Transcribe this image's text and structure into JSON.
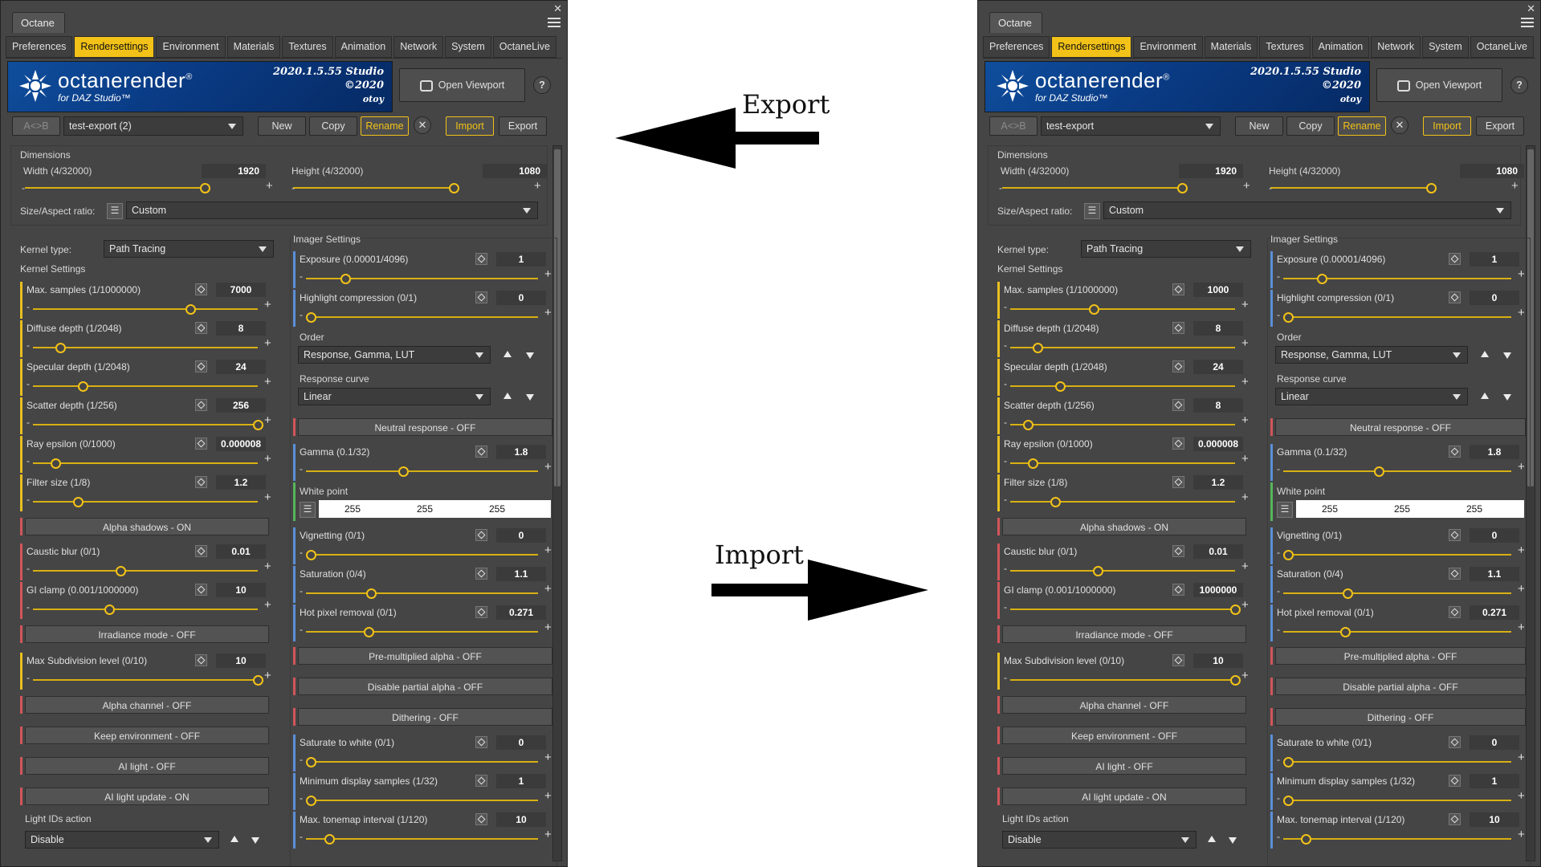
{
  "annotations": {
    "export_label": "Export",
    "import_label": "Import"
  },
  "panels": [
    {
      "window_title": "Octane",
      "tabs": [
        "Preferences",
        "Rendersettings",
        "Environment",
        "Materials",
        "Textures",
        "Animation",
        "Network",
        "System",
        "OctaneLive"
      ],
      "active_tab": "Rendersettings",
      "banner": {
        "brand": "octanerender",
        "brand_mark": "®",
        "subtitle": "for DAZ Studio™",
        "version_line1": "2020.1.5.55 Studio",
        "version_line2": "©2020",
        "company": "otoy"
      },
      "open_viewport_label": "Open Viewport",
      "help_label": "?",
      "toolbar": {
        "ab_label": "A<>B",
        "preset": "test-export (2)",
        "new": "New",
        "copy": "Copy",
        "rename": "Rename",
        "import": "Import",
        "export": "Export"
      },
      "dimensions": {
        "title": "Dimensions",
        "width_label": "Width (4/32000)",
        "width": "1920",
        "height_label": "Height (4/32000)",
        "height": "1080",
        "aspect_label": "Size/Aspect ratio:",
        "aspect_value": "Custom"
      },
      "kernel": {
        "type_label": "Kernel type:",
        "type_value": "Path Tracing",
        "settings_title": "Kernel Settings"
      },
      "kernel_params": [
        {
          "label": "Max. samples (1/1000000)",
          "value": "7000",
          "pos": 0.7
        },
        {
          "label": "Diffuse depth (1/2048)",
          "value": "8",
          "pos": 0.12
        },
        {
          "label": "Specular depth (1/2048)",
          "value": "24",
          "pos": 0.22
        },
        {
          "label": "Scatter depth (1/256)",
          "value": "256",
          "pos": 1.0
        },
        {
          "label": "Ray epsilon (0/1000)",
          "value": "0.000008",
          "pos": 0.1
        },
        {
          "label": "Filter size (1/8)",
          "value": "1.2",
          "pos": 0.2
        }
      ],
      "toggle_alpha_shadows": "Alpha shadows - ON",
      "kernel_params_2": [
        {
          "label": "Caustic blur (0/1)",
          "value": "0.01",
          "pos": 0.39
        },
        {
          "label": "GI clamp (0.001/1000000)",
          "value": "10",
          "pos": 0.34
        }
      ],
      "toggle_irradiance": "Irradiance mode - OFF",
      "kernel_params_3": [
        {
          "label": "Max Subdivision level (0/10)",
          "value": "10",
          "pos": 1.0
        }
      ],
      "kernel_toggles": [
        "Alpha channel - OFF",
        "Keep environment - OFF",
        "AI light - OFF",
        "AI light update - ON"
      ],
      "light_ids": {
        "label": "Light IDs action",
        "value": "Disable"
      },
      "imager": {
        "title": "Imager Settings"
      },
      "imager_params_1": [
        {
          "label": "Exposure (0.00001/4096)",
          "value": "1",
          "pos": 0.17
        },
        {
          "label": "Highlight compression (0/1)",
          "value": "0",
          "pos": 0.02
        }
      ],
      "order": {
        "label": "Order",
        "value": "Response, Gamma, LUT"
      },
      "response_curve": {
        "label": "Response curve",
        "value": "Linear"
      },
      "toggle_neutral": "Neutral response - OFF",
      "imager_params_2": [
        {
          "label": "Gamma (0.1/32)",
          "value": "1.8",
          "pos": 0.42
        }
      ],
      "white_point": {
        "label": "White point",
        "r": "255",
        "g": "255",
        "b": "255"
      },
      "imager_params_3": [
        {
          "label": "Vignetting (0/1)",
          "value": "0",
          "pos": 0.02
        },
        {
          "label": "Saturation (0/4)",
          "value": "1.1",
          "pos": 0.28
        },
        {
          "label": "Hot pixel removal (0/1)",
          "value": "0.271",
          "pos": 0.27
        }
      ],
      "imager_toggles": [
        "Pre-multiplied alpha - OFF",
        "Disable partial alpha - OFF",
        "Dithering - OFF"
      ],
      "imager_params_4": [
        {
          "label": "Saturate to white (0/1)",
          "value": "0",
          "pos": 0.02
        },
        {
          "label": "Minimum display samples (1/32)",
          "value": "1",
          "pos": 0.02
        },
        {
          "label": "Max. tonemap interval (1/120)",
          "value": "10",
          "pos": 0.1
        }
      ]
    },
    {
      "window_title": "Octane",
      "tabs": [
        "Preferences",
        "Rendersettings",
        "Environment",
        "Materials",
        "Textures",
        "Animation",
        "Network",
        "System",
        "OctaneLive"
      ],
      "active_tab": "Rendersettings",
      "banner": {
        "brand": "octanerender",
        "brand_mark": "®",
        "subtitle": "for DAZ Studio™",
        "version_line1": "2020.1.5.55 Studio",
        "version_line2": "©2020",
        "company": "otoy"
      },
      "open_viewport_label": "Open Viewport",
      "help_label": "?",
      "toolbar": {
        "ab_label": "A<>B",
        "preset": "test-export",
        "new": "New",
        "copy": "Copy",
        "rename": "Rename",
        "import": "Import",
        "export": "Export"
      },
      "dimensions": {
        "title": "Dimensions",
        "width_label": "Width (4/32000)",
        "width": "1920",
        "height_label": "Height (4/32000)",
        "height": "1080",
        "aspect_label": "Size/Aspect ratio:",
        "aspect_value": "Custom"
      },
      "kernel": {
        "type_label": "Kernel type:",
        "type_value": "Path Tracing",
        "settings_title": "Kernel Settings"
      },
      "kernel_params": [
        {
          "label": "Max. samples (1/1000000)",
          "value": "1000",
          "pos": 0.37
        },
        {
          "label": "Diffuse depth (1/2048)",
          "value": "8",
          "pos": 0.12
        },
        {
          "label": "Specular depth (1/2048)",
          "value": "24",
          "pos": 0.22
        },
        {
          "label": "Scatter depth (1/256)",
          "value": "8",
          "pos": 0.08
        },
        {
          "label": "Ray epsilon (0/1000)",
          "value": "0.000008",
          "pos": 0.1
        },
        {
          "label": "Filter size (1/8)",
          "value": "1.2",
          "pos": 0.2
        }
      ],
      "toggle_alpha_shadows": "Alpha shadows - ON",
      "kernel_params_2": [
        {
          "label": "Caustic blur (0/1)",
          "value": "0.01",
          "pos": 0.39
        },
        {
          "label": "GI clamp (0.001/1000000)",
          "value": "1000000",
          "pos": 1.0
        }
      ],
      "toggle_irradiance": "Irradiance mode - OFF",
      "kernel_params_3": [
        {
          "label": "Max Subdivision level (0/10)",
          "value": "10",
          "pos": 1.0
        }
      ],
      "kernel_toggles": [
        "Alpha channel - OFF",
        "Keep environment - OFF",
        "AI light - OFF",
        "AI light update - ON"
      ],
      "light_ids": {
        "label": "Light IDs action",
        "value": "Disable"
      },
      "imager": {
        "title": "Imager Settings"
      },
      "imager_params_1": [
        {
          "label": "Exposure (0.00001/4096)",
          "value": "1",
          "pos": 0.17
        },
        {
          "label": "Highlight compression (0/1)",
          "value": "0",
          "pos": 0.02
        }
      ],
      "order": {
        "label": "Order",
        "value": "Response, Gamma, LUT"
      },
      "response_curve": {
        "label": "Response curve",
        "value": "Linear"
      },
      "toggle_neutral": "Neutral response - OFF",
      "imager_params_2": [
        {
          "label": "Gamma (0.1/32)",
          "value": "1.8",
          "pos": 0.42
        }
      ],
      "white_point": {
        "label": "White point",
        "r": "255",
        "g": "255",
        "b": "255"
      },
      "imager_params_3": [
        {
          "label": "Vignetting (0/1)",
          "value": "0",
          "pos": 0.02
        },
        {
          "label": "Saturation (0/4)",
          "value": "1.1",
          "pos": 0.28
        },
        {
          "label": "Hot pixel removal (0/1)",
          "value": "0.271",
          "pos": 0.27
        }
      ],
      "imager_toggles": [
        "Pre-multiplied alpha - OFF",
        "Disable partial alpha - OFF",
        "Dithering - OFF"
      ],
      "imager_params_4": [
        {
          "label": "Saturate to white (0/1)",
          "value": "0",
          "pos": 0.02
        },
        {
          "label": "Minimum display samples (1/32)",
          "value": "1",
          "pos": 0.02
        },
        {
          "label": "Max. tonemap interval (1/120)",
          "value": "10",
          "pos": 0.1
        }
      ]
    }
  ],
  "colors": {
    "accent": "#f2c218",
    "panel_bg": "#454545",
    "banner_blue": "#0a3c86",
    "bar_yellow": "#e8c020",
    "bar_blue": "#5b8fd8",
    "bar_red": "#d2555a",
    "bar_green": "#57b55a"
  }
}
